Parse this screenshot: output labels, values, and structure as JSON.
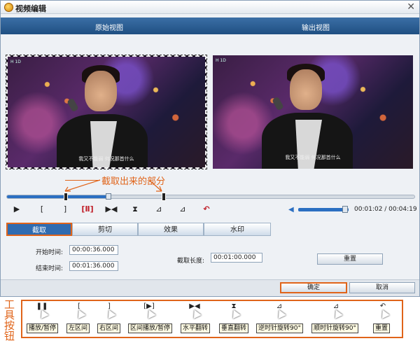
{
  "window": {
    "title": "视频编辑",
    "close": "✕"
  },
  "views": {
    "original": "原始视图",
    "output": "输出视图"
  },
  "video": {
    "logo": "H 1D",
    "subtitle": "我又不能弱  何况那首什么"
  },
  "annotation": "截取出来的部分",
  "timeline": {
    "progress": 0.25,
    "start_mark": 0.14,
    "end_mark": 0.38
  },
  "controls": {
    "play": "▶",
    "left_bracket": "[",
    "right_bracket": "]",
    "interval_play": "[Ⅱ]",
    "flip_h": "▶◀",
    "flip_v": "⧗",
    "rotate_ccw": "⊿",
    "rotate_cw": "⊿",
    "reset": "↶"
  },
  "volume": {
    "level": 0.93
  },
  "time": "00:01:02 / 00:04:19",
  "tabs": [
    "截取",
    "剪切",
    "效果",
    "水印"
  ],
  "form": {
    "start_label": "开始时间:",
    "start_value": "00:00:36.000",
    "end_label": "结束时间:",
    "end_value": "00:01:36.000",
    "length_label": "截取长度:",
    "length_value": "00:01:00.000",
    "reset_button": "重置"
  },
  "footer": {
    "ok": "确定",
    "cancel": "取消"
  },
  "legend": {
    "title": "工具按钮",
    "items": [
      {
        "icon": "❚❚",
        "label": "播放/暂停"
      },
      {
        "icon": "[",
        "label": "左区间"
      },
      {
        "icon": "]",
        "label": "右区间"
      },
      {
        "icon": "[▶]",
        "label": "区间播放/暂停"
      },
      {
        "icon": "▶◀",
        "label": "水平翻转"
      },
      {
        "icon": "⧗",
        "label": "垂直翻转"
      },
      {
        "icon": "⊿",
        "label": "逆时针旋转90°"
      },
      {
        "icon": "⊿",
        "label": "顺时针旋转90°"
      },
      {
        "icon": "↶",
        "label": "重置"
      }
    ]
  },
  "colors": {
    "accent": "#e0641a",
    "header": "#2f5f94",
    "progress": "#2b6fc2"
  }
}
